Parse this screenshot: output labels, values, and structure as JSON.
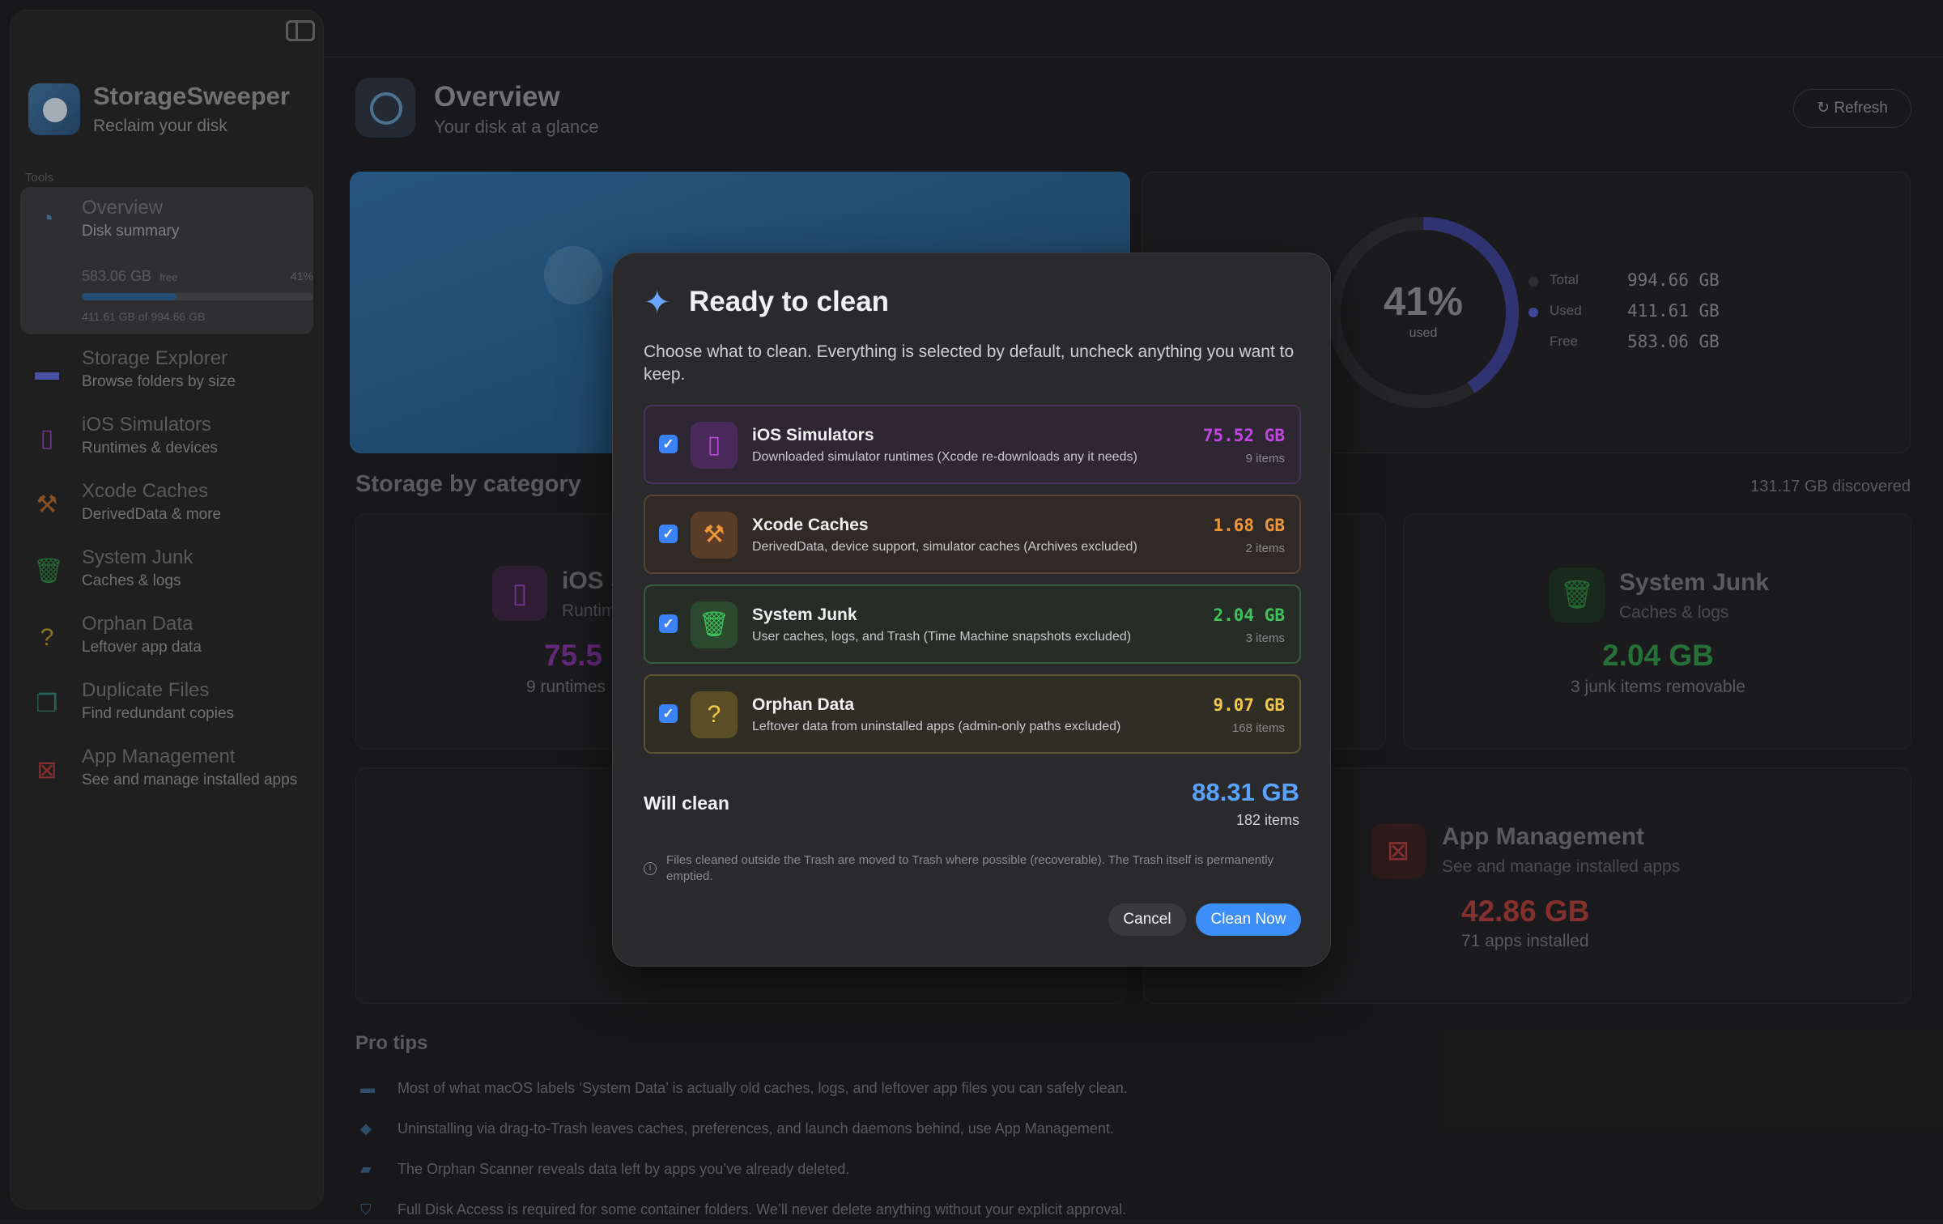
{
  "sidebar": {
    "brand_title": "StorageSweeper",
    "brand_sub": "Reclaim your disk",
    "section_label": "Tools",
    "overview": {
      "title": "Overview",
      "sub": "Disk summary",
      "free": "583.06 GB",
      "free_label": "free",
      "pct": "41%",
      "used_fraction": 0.41,
      "used_text": "411.61 GB of 994.66 GB"
    },
    "items": [
      {
        "title": "Storage Explorer",
        "sub": "Browse folders by size",
        "icon": "drive-icon"
      },
      {
        "title": "iOS Simulators",
        "sub": "Runtimes & devices",
        "icon": "phone-icon"
      },
      {
        "title": "Xcode Caches",
        "sub": "DerivedData & more",
        "icon": "hammer-icon"
      },
      {
        "title": "System Junk",
        "sub": "Caches & logs",
        "icon": "trash-icon"
      },
      {
        "title": "Orphan Data",
        "sub": "Leftover app data",
        "icon": "folder-question-icon"
      },
      {
        "title": "Duplicate Files",
        "sub": "Find redundant copies",
        "icon": "documents-icon"
      },
      {
        "title": "App Management",
        "sub": "See and manage installed apps",
        "icon": "archive-box-icon"
      }
    ]
  },
  "header": {
    "title": "Overview",
    "subtitle": "Your disk at a glance",
    "refresh_label": "Refresh"
  },
  "disk": {
    "pct": "41%",
    "pct_label": "used",
    "used_fraction": 0.41,
    "legend": [
      {
        "name": "Total",
        "value": "994.66 GB",
        "color": "#3a3a3d"
      },
      {
        "name": "Used",
        "value": "411.61 GB",
        "color": "#4e56b8"
      },
      {
        "name": "Free",
        "value": "583.06 GB",
        "color": "#222224"
      }
    ]
  },
  "category": {
    "title": "Storage by category",
    "discovered": "131.17 GB discovered",
    "cards": {
      "sim": {
        "title": "iOS S",
        "sub": "Runtim",
        "big": "75.5",
        "note": "9 runtimes"
      },
      "junk": {
        "title": "System Junk",
        "sub": "Caches & logs",
        "big": "2.04 GB",
        "note": "3 junk items removable"
      },
      "apps": {
        "title": "App Management",
        "sub": "See and manage installed apps",
        "big": "42.86 GB",
        "note": "71 apps installed"
      }
    }
  },
  "tips": {
    "title": "Pro tips",
    "items": [
      "Most of what macOS labels ‘System Data’ is actually old caches, logs, and leftover app files you can safely clean.",
      "Uninstalling via drag-to-Trash leaves caches, preferences, and launch daemons behind, use App Management.",
      "The Orphan Scanner reveals data left by apps you’ve already deleted.",
      "Full Disk Access is required for some container folders. We’ll never delete anything without your explicit approval."
    ]
  },
  "modal": {
    "title": "Ready to clean",
    "description": "Choose what to clean. Everything is selected by default, uncheck anything you want to keep.",
    "rows": [
      {
        "title": "iOS Simulators",
        "sub": "Downloaded simulator runtimes (Xcode re-downloads any it needs)",
        "size": "75.52 GB",
        "count": "9 items",
        "checked": true
      },
      {
        "title": "Xcode Caches",
        "sub": "DerivedData, device support, simulator caches (Archives excluded)",
        "size": "1.68 GB",
        "count": "2 items",
        "checked": true
      },
      {
        "title": "System Junk",
        "sub": "User caches, logs, and Trash (Time Machine snapshots excluded)",
        "size": "2.04 GB",
        "count": "3 items",
        "checked": true
      },
      {
        "title": "Orphan Data",
        "sub": "Leftover data from uninstalled apps (admin-only paths excluded)",
        "size": "9.07 GB",
        "count": "168 items",
        "checked": true
      }
    ],
    "will_clean_label": "Will clean",
    "will_clean_size": "88.31 GB",
    "will_clean_count": "182 items",
    "note": "Files cleaned outside the Trash are moved to Trash where possible (recoverable). The Trash itself is permanently emptied.",
    "cancel_label": "Cancel",
    "clean_label": "Clean Now"
  },
  "colors": {
    "accent": "#3d8ef8",
    "simulators": "#c046e0",
    "xcode": "#f0963a",
    "junk": "#3fc25a",
    "orphan": "#f2c94c"
  }
}
